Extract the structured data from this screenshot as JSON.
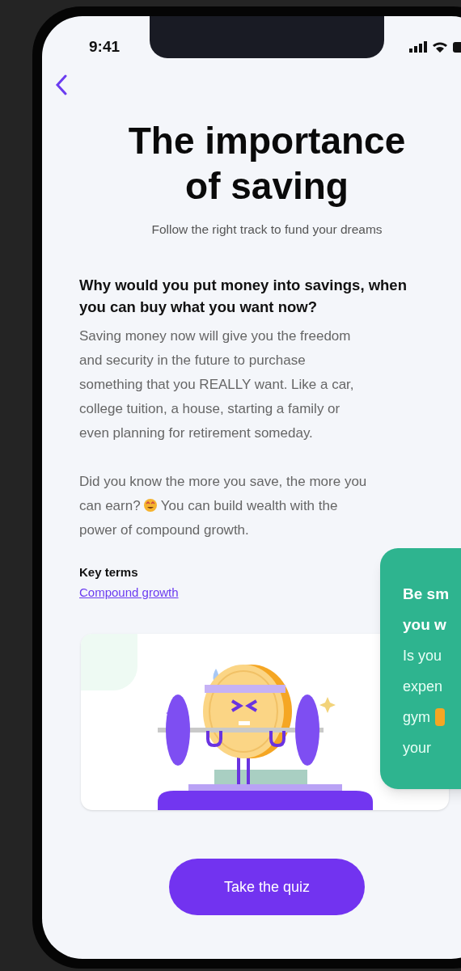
{
  "status_bar": {
    "time": "9:41"
  },
  "title": "The importance of saving",
  "subtitle": "Follow the right track to fund your dreams",
  "heading": "Why would you put money into savings, when you can buy what you want now?",
  "intro_paragraph": "Saving money now will give you the freedom and security in the future to purchase something that you REALLY want. Like a car, college tuition, a house, starting a family or even planning for retirement someday.",
  "growth_paragraph": {
    "before_emoji": "Did you know the more you save, the more you can earn?",
    "after_emoji": "You can build wealth with the power of compound growth."
  },
  "key_terms": {
    "label": "Key terms",
    "terms": [
      "Compound growth"
    ]
  },
  "tip_card": {
    "title_lines": [
      "Be sm",
      "you w"
    ],
    "body_lines": [
      "Is you",
      "expen",
      "gym",
      "your"
    ]
  },
  "quiz_button": "Take the quiz"
}
